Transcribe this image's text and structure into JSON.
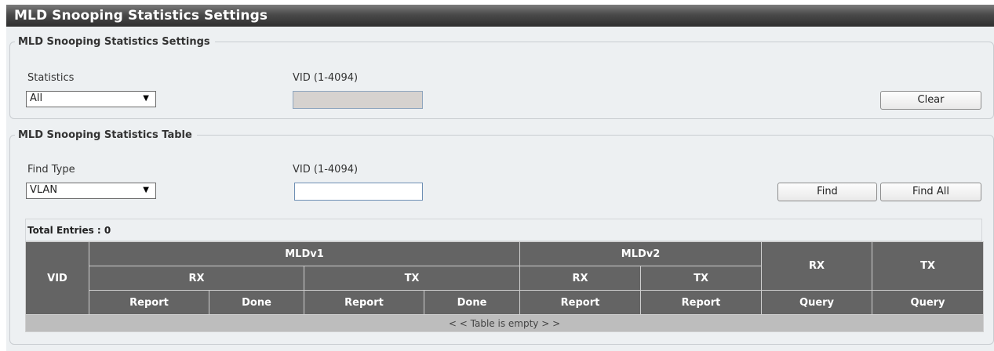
{
  "page_title": "MLD Snooping Statistics Settings",
  "settings": {
    "legend": "MLD Snooping Statistics Settings",
    "statistics_label": "Statistics",
    "statistics_value": "All",
    "vid_label": "VID (1-4094)",
    "vid_value": "",
    "clear_label": "Clear"
  },
  "table_section": {
    "legend": "MLD Snooping Statistics Table",
    "find_type_label": "Find Type",
    "find_type_value": "VLAN",
    "vid_label": "VID (1-4094)",
    "vid_value": "",
    "find_label": "Find",
    "find_all_label": "Find All",
    "total_entries": "Total Entries : 0",
    "headers": {
      "vid": "VID",
      "mldv1": "MLDv1",
      "mldv2": "MLDv2",
      "rx": "RX",
      "tx": "TX",
      "rx_query_group": "RX",
      "tx_query_group": "TX",
      "cols": [
        "Report",
        "Done",
        "Report",
        "Done",
        "Report",
        "Report",
        "Query",
        "Query"
      ]
    },
    "empty_text": "< < Table is empty > >"
  }
}
